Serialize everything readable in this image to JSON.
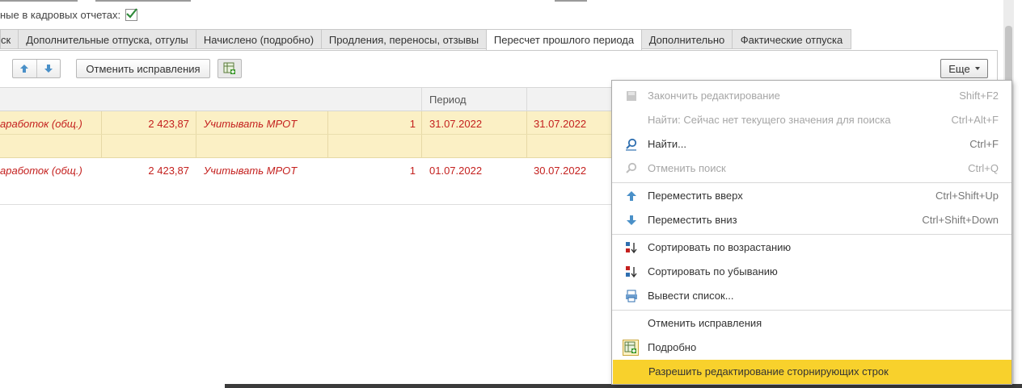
{
  "header": {
    "hr_reports_label": "ные в кадровых отчетах:",
    "hr_reports_checked": true
  },
  "tabs": [
    {
      "label": "ск"
    },
    {
      "label": "Дополнительные отпуска, отгулы"
    },
    {
      "label": "Начислено (подробно)"
    },
    {
      "label": "Продления, переносы, отзывы"
    },
    {
      "label": "Пересчет прошлого периода",
      "active": true
    },
    {
      "label": "Дополнительно"
    },
    {
      "label": "Фактические отпуска"
    }
  ],
  "toolbar": {
    "cancel_corrections_label": "Отменить исправления",
    "more_label": "Еще"
  },
  "grid": {
    "headers": {
      "period": "Период"
    },
    "rows": [
      {
        "type": "аработок (общ.)",
        "amount": "2 423,87",
        "mrot": "Учитывать МРОТ",
        "qty": "1",
        "start": "31.07.2022",
        "end": "31.07.2022",
        "selected": true
      },
      {
        "type": "аработок (общ.)",
        "amount": "2 423,87",
        "mrot": "Учитывать МРОТ",
        "qty": "1",
        "start": "01.07.2022",
        "end": "30.07.2022",
        "selected": false
      }
    ]
  },
  "menu": {
    "items": [
      {
        "label": "Закончить редактирование",
        "shortcut": "Shift+F2",
        "icon": "finish-edit-icon",
        "disabled": true
      },
      {
        "label": "Найти: Сейчас нет текущего значения для поиска",
        "shortcut": "Ctrl+Alt+F",
        "icon": "",
        "disabled": true
      },
      {
        "label": "Найти...",
        "shortcut": "Ctrl+F",
        "icon": "search-icon"
      },
      {
        "label": "Отменить поиск",
        "shortcut": "Ctrl+Q",
        "icon": "cancel-search-icon",
        "disabled": true
      },
      {
        "label": "Переместить вверх",
        "shortcut": "Ctrl+Shift+Up",
        "icon": "arrow-up-icon"
      },
      {
        "label": "Переместить вниз",
        "shortcut": "Ctrl+Shift+Down",
        "icon": "arrow-down-icon"
      },
      {
        "label": "Сортировать по возрастанию",
        "shortcut": "",
        "icon": "sort-ascending-icon"
      },
      {
        "label": "Сортировать по убыванию",
        "shortcut": "",
        "icon": "sort-descending-icon"
      },
      {
        "label": "Вывести список...",
        "shortcut": "",
        "icon": "output-list-icon"
      },
      {
        "label": "Отменить исправления",
        "shortcut": "",
        "icon": ""
      },
      {
        "label": "Подробно",
        "shortcut": "",
        "icon": "details-icon"
      },
      {
        "label": "Разрешить редактирование сторнирующих строк",
        "shortcut": "",
        "icon": "",
        "highlighted": true
      }
    ]
  },
  "colors": {
    "accent_blue": "#4a90c8",
    "highlight": "#f8d12c",
    "selected_row": "#fbf0c5",
    "value_red": "#c4201e",
    "check_green": "#2f8a3a"
  }
}
